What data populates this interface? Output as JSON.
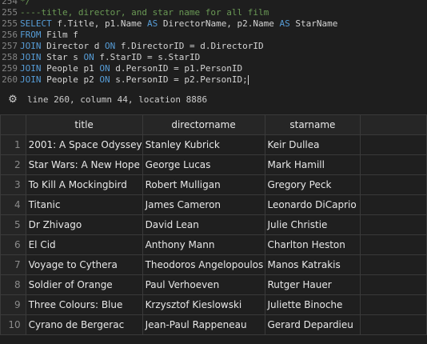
{
  "editor": {
    "lines": [
      {
        "num": "254",
        "tokens": [
          {
            "t": "*/",
            "c": "cm"
          }
        ]
      },
      {
        "num": "255",
        "tokens": [
          {
            "t": "----title, director, and star name for all film",
            "c": "cm"
          }
        ]
      },
      {
        "num": "255",
        "tokens": [
          {
            "t": "SELECT",
            "c": "kw"
          },
          {
            "t": " f.Title, p1.Name ",
            "c": "tx"
          },
          {
            "t": "AS",
            "c": "kw"
          },
          {
            "t": " DirectorName, p2.Name ",
            "c": "tx"
          },
          {
            "t": "AS",
            "c": "kw"
          },
          {
            "t": " StarName",
            "c": "tx"
          }
        ]
      },
      {
        "num": "256",
        "tokens": [
          {
            "t": "FROM",
            "c": "kw"
          },
          {
            "t": " Film f",
            "c": "tx"
          }
        ]
      },
      {
        "num": "257",
        "tokens": [
          {
            "t": "JOIN",
            "c": "kw"
          },
          {
            "t": " Director d ",
            "c": "tx"
          },
          {
            "t": "ON",
            "c": "kw"
          },
          {
            "t": " f.DirectorID = d.DirectorID",
            "c": "tx"
          }
        ]
      },
      {
        "num": "258",
        "tokens": [
          {
            "t": "JOIN",
            "c": "kw"
          },
          {
            "t": " Star s ",
            "c": "tx"
          },
          {
            "t": "ON",
            "c": "kw"
          },
          {
            "t": " f.StarID = s.StarID",
            "c": "tx"
          }
        ]
      },
      {
        "num": "259",
        "tokens": [
          {
            "t": "JOIN",
            "c": "kw"
          },
          {
            "t": " People p1 ",
            "c": "tx"
          },
          {
            "t": "ON",
            "c": "kw"
          },
          {
            "t": " d.PersonID = p1.PersonID",
            "c": "tx"
          }
        ]
      },
      {
        "num": "260",
        "tokens": [
          {
            "t": "JOIN",
            "c": "kw"
          },
          {
            "t": " People p2 ",
            "c": "tx"
          },
          {
            "t": "ON",
            "c": "kw"
          },
          {
            "t": " s.PersonID = p2.PersonID;",
            "c": "tx"
          }
        ]
      }
    ]
  },
  "status": {
    "icon": "gear-icon",
    "text": "line 260, column 44, location 8886"
  },
  "results": {
    "columns": [
      "title",
      "directorname",
      "starname"
    ],
    "rows": [
      [
        "1",
        "2001: A Space Odyssey",
        "Stanley Kubrick",
        "Keir Dullea"
      ],
      [
        "2",
        "Star Wars: A New Hope",
        "George Lucas",
        "Mark Hamill"
      ],
      [
        "3",
        "To Kill A Mockingbird",
        "Robert Mulligan",
        "Gregory Peck"
      ],
      [
        "4",
        "Titanic",
        "James Cameron",
        "Leonardo DiCaprio"
      ],
      [
        "5",
        "Dr Zhivago",
        "David Lean",
        "Julie Christie"
      ],
      [
        "6",
        "El Cid",
        "Anthony Mann",
        "Charlton Heston"
      ],
      [
        "7",
        "Voyage to Cythera",
        "Theodoros Angelopoulos",
        "Manos Katrakis"
      ],
      [
        "8",
        "Soldier of Orange",
        "Paul Verhoeven",
        "Rutger Hauer"
      ],
      [
        "9",
        "Three Colours: Blue",
        "Krzysztof Kieslowski",
        "Juliette Binoche"
      ],
      [
        "10",
        "Cyrano de Bergerac",
        "Jean-Paul Rappeneau",
        "Gerard Depardieu"
      ]
    ]
  }
}
